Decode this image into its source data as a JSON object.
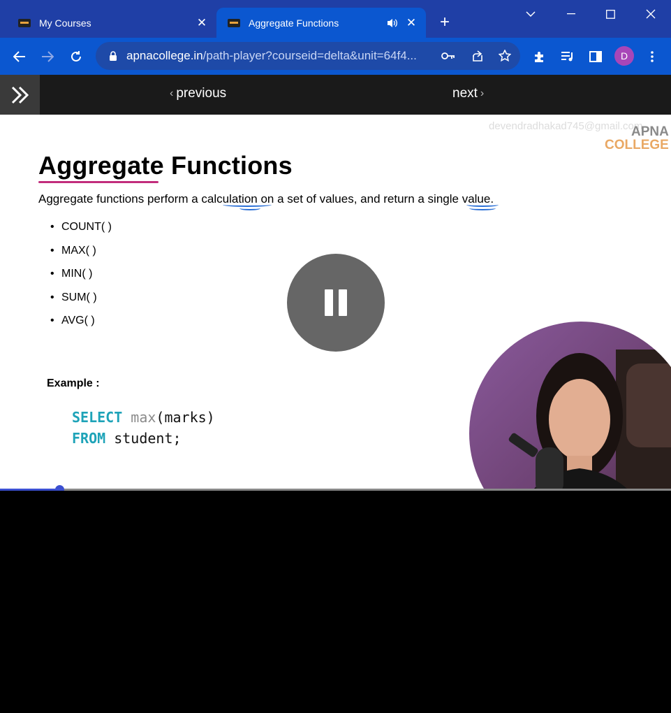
{
  "tabs": [
    {
      "title": "My Courses",
      "active": false
    },
    {
      "title": "Aggregate Functions",
      "active": true
    }
  ],
  "toolbar": {
    "url_domain": "apnacollege.in",
    "url_path": "/path-player?courseid=delta&unit=64f4...",
    "avatar_initial": "D"
  },
  "player_nav": {
    "previous_label": "previous",
    "next_label": "next"
  },
  "video": {
    "watermark": "devendradhakad745@gmail.com",
    "logo_line1": "APNA",
    "logo_line2": "COLLEGE",
    "slide_title": "Aggregate Functions",
    "description": "Aggregate functions perform a calculation on a set of values, and return a single value.",
    "functions": [
      "COUNT( )",
      "MAX( )",
      "MIN( )",
      "SUM( )",
      "AVG( )"
    ],
    "example_label": "Example :",
    "code": {
      "kw1": "SELECT",
      "fn": "max",
      "rest1": "(marks)",
      "kw2": "FROM",
      "rest2": "student;"
    },
    "progress": 0.088
  },
  "colors": {
    "tabbar": "#1f3fa6",
    "toolbar": "#0b57d0",
    "accent_underline": "#c22d7c",
    "sql_keyword": "#1ea3b8",
    "progress": "#3b4fd0"
  }
}
